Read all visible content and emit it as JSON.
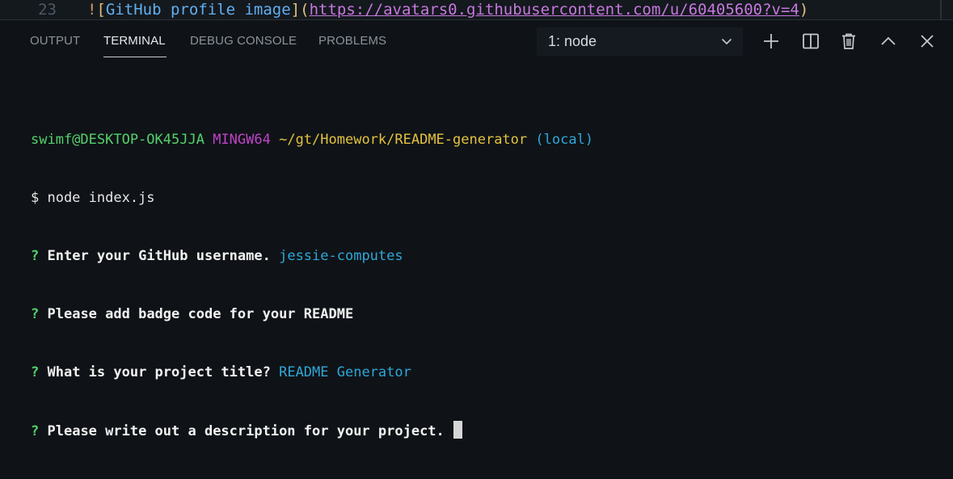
{
  "editor": {
    "line_number": "23",
    "code_bang": "!",
    "code_open_bracket": "[",
    "code_alt_text": "GitHub profile image",
    "code_close_bracket": "]",
    "code_open_paren": "(",
    "code_url": "https://avatars0.githubusercontent.com/u/60405600?v=4",
    "code_close_paren": ")"
  },
  "panel": {
    "tabs": [
      {
        "label": "OUTPUT",
        "active": false
      },
      {
        "label": "TERMINAL",
        "active": true
      },
      {
        "label": "DEBUG CONSOLE",
        "active": false
      },
      {
        "label": "PROBLEMS",
        "active": false
      }
    ],
    "terminal_selector": {
      "selected": "1: node"
    },
    "actions": [
      {
        "icon": "plus-icon",
        "name": "new-terminal"
      },
      {
        "icon": "split-icon",
        "name": "split-terminal"
      },
      {
        "icon": "trash-icon",
        "name": "kill-terminal"
      },
      {
        "icon": "chevron-up-icon",
        "name": "maximize-panel"
      },
      {
        "icon": "close-icon",
        "name": "close-panel"
      }
    ]
  },
  "terminal": {
    "prompt": {
      "user_host": "swimf@DESKTOP-OK45JJA",
      "shell": "MINGW64",
      "path": "~/gt/Homework/README-generator",
      "branch": "(local)"
    },
    "command": "$ node index.js",
    "questions": [
      {
        "mark": "?",
        "text": "Enter your GitHub username.",
        "answer": "jessie-computes"
      },
      {
        "mark": "?",
        "text": "Please add badge code for your README",
        "answer": ""
      },
      {
        "mark": "?",
        "text": "What is your project title?",
        "answer": "README Generator"
      },
      {
        "mark": "?",
        "text": "Please write out a description for your project.",
        "answer": ""
      }
    ]
  },
  "colors": {
    "background": "#0f1317",
    "user_host": "#54d16c",
    "shell": "#c043c9",
    "path": "#e3c23f",
    "branch": "#2fa7d8",
    "answer": "#2fa7d8"
  }
}
